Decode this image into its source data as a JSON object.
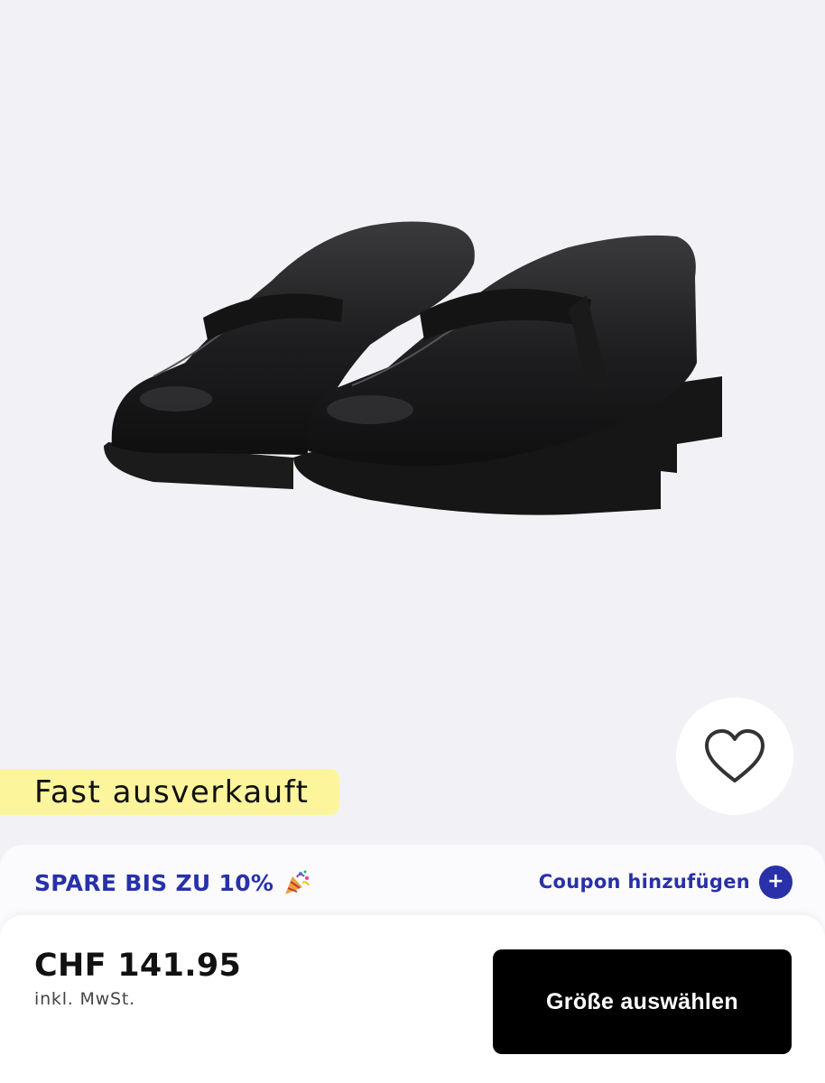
{
  "product": {
    "stock_badge": "Fast ausverkauft"
  },
  "coupon": {
    "promo_text": "SPARE BIS ZU 10%",
    "add_label": "Coupon hinzufügen",
    "add_icon": "plus-icon"
  },
  "checkout": {
    "price": "CHF 141.95",
    "tax_note": "inkl. MwSt.",
    "size_button_label": "Größe auswählen"
  },
  "colors": {
    "accent": "#2831a8",
    "badge": "#fdf59c",
    "background": "#f2f2f6",
    "primary_button": "#000000"
  }
}
